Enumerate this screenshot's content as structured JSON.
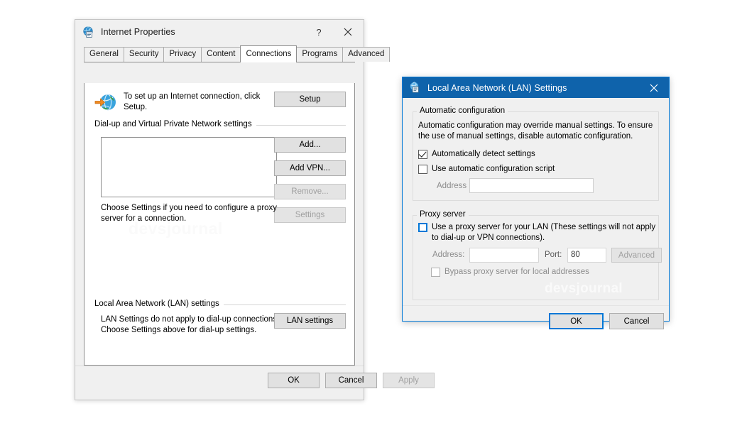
{
  "internet_properties": {
    "title": "Internet Properties",
    "titlebar_icon": "internet-properties-icon",
    "help_label": "?",
    "close_label": "close-icon",
    "tabs": [
      {
        "label": "General",
        "active": false
      },
      {
        "label": "Security",
        "active": false
      },
      {
        "label": "Privacy",
        "active": false
      },
      {
        "label": "Content",
        "active": false
      },
      {
        "label": "Connections",
        "active": true
      },
      {
        "label": "Programs",
        "active": false
      },
      {
        "label": "Advanced",
        "active": false
      }
    ],
    "setup": {
      "icon": "globe-connection-icon",
      "text": "To set up an Internet connection, click Setup.",
      "button": "Setup"
    },
    "dialup_group": {
      "label": "Dial-up and Virtual Private Network settings",
      "listbox_value": "",
      "buttons": [
        {
          "label": "Add...",
          "disabled": false
        },
        {
          "label": "Add VPN...",
          "disabled": false
        },
        {
          "label": "Remove...",
          "disabled": true
        },
        {
          "label": "Settings",
          "disabled": true
        }
      ],
      "hint": "Choose Settings if you need to configure a proxy server for a connection."
    },
    "lan_group": {
      "label": "Local Area Network (LAN) settings",
      "hint": "LAN Settings do not apply to dial-up connections. Choose Settings above for dial-up settings.",
      "button": "LAN settings"
    },
    "footer": {
      "ok": "OK",
      "cancel": "Cancel",
      "apply": "Apply",
      "apply_disabled": true
    },
    "watermark": "devsjournal"
  },
  "lan_settings": {
    "title": "Local Area Network (LAN) Settings",
    "titlebar_icon": "lan-settings-icon",
    "close_label": "close-icon",
    "titlebar_color": "#0f63ab",
    "accent_color": "#0078d7",
    "automatic_configuration": {
      "group_label": "Automatic configuration",
      "description": "Automatic configuration may override manual settings.  To ensure the use of manual settings, disable automatic configuration.",
      "auto_detect": {
        "label": "Automatically detect settings",
        "checked": true
      },
      "use_script": {
        "label": "Use automatic configuration script",
        "checked": false
      },
      "address_label": "Address",
      "address_value": "",
      "address_disabled": true
    },
    "proxy_server": {
      "group_label": "Proxy server",
      "use_proxy": {
        "label": "Use a proxy server for your LAN (These settings will not apply to dial-up or VPN connections).",
        "checked": false,
        "hovered": true
      },
      "address_label": "Address:",
      "address_value": "",
      "port_label": "Port:",
      "port_value": "80",
      "advanced_button": "Advanced",
      "bypass": {
        "label": "Bypass proxy server for local addresses",
        "checked": false
      },
      "disabled": true
    },
    "footer": {
      "ok": "OK",
      "ok_focused": true,
      "cancel": "Cancel"
    },
    "watermark": "devsjournal"
  }
}
